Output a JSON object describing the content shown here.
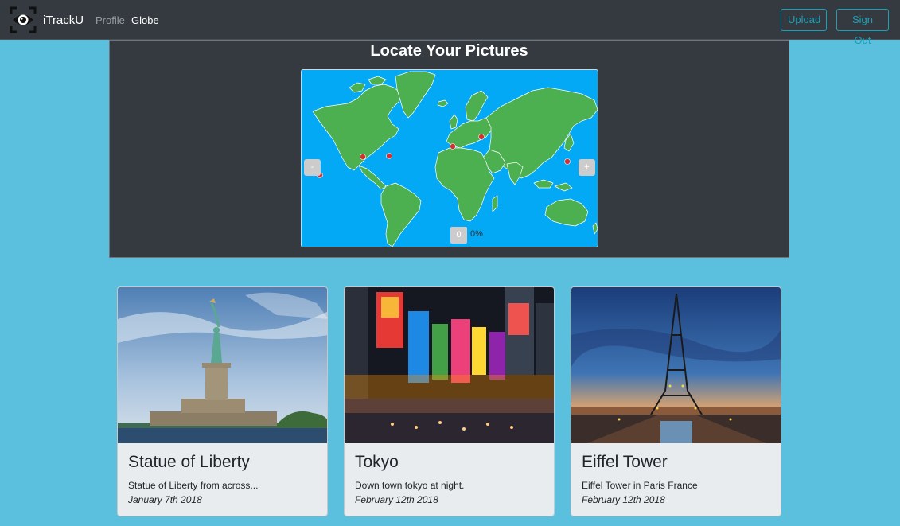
{
  "navbar": {
    "brand": "iTrackU",
    "links": [
      {
        "label": "Profile"
      },
      {
        "label": "Globe"
      }
    ],
    "upload_label": "Upload",
    "signout_label": "Sign Out"
  },
  "globe": {
    "title": "Locate Your Pictures",
    "zoom_out": "-",
    "zoom_in": "+",
    "count": "0",
    "percent": "0%"
  },
  "cards": [
    {
      "title": "Statue of Liberty",
      "description": "Statue of Liberty from across...",
      "date": "January 7th 2018"
    },
    {
      "title": "Tokyo",
      "description": "Down town tokyo at night.",
      "date": "February 12th 2018"
    },
    {
      "title": "Eiffel Tower",
      "description": "Eiffel Tower in Paris France",
      "date": "February 12th 2018"
    }
  ],
  "colors": {
    "background": "#5bc0de",
    "navbar": "#343a40",
    "accent": "#17a2b8",
    "ocean": "#03a9f4",
    "land": "#4caf50",
    "marker": "#d32f2f"
  }
}
